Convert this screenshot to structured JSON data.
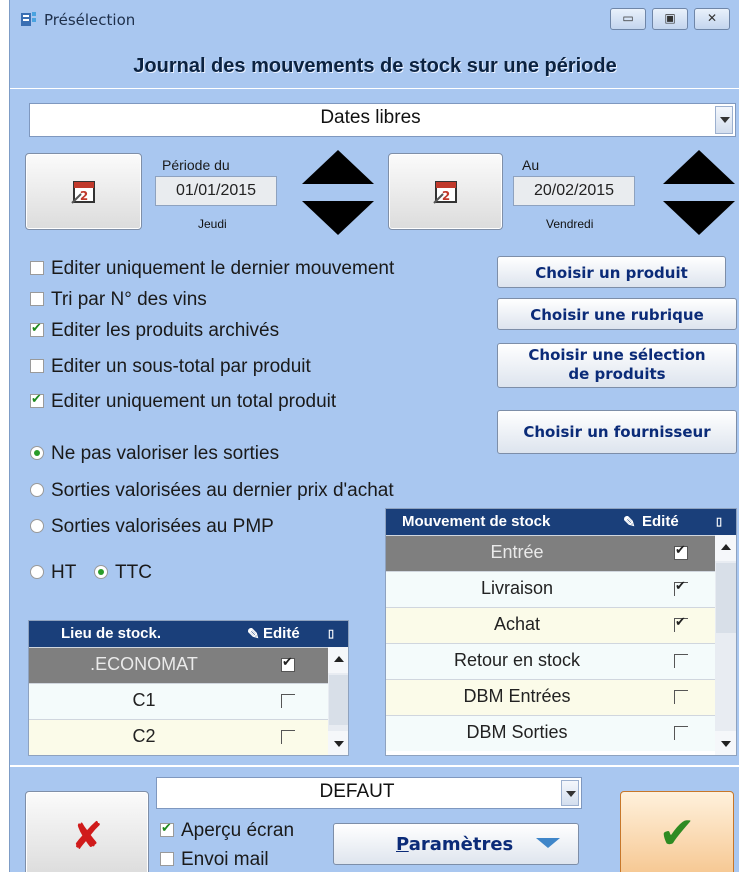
{
  "window": {
    "title": "Présélection",
    "header": "Journal des mouvements de stock sur une période"
  },
  "period_combo": {
    "value": "Dates libres"
  },
  "start": {
    "label": "Période du",
    "date": "01/01/2015",
    "day": "Jeudi"
  },
  "end": {
    "label": "Au",
    "date": "20/02/2015",
    "day": "Vendredi"
  },
  "checkboxes": [
    {
      "label": "Editer uniquement le dernier mouvement",
      "checked": false
    },
    {
      "label": "Tri par N° des vins",
      "checked": false
    },
    {
      "label": "Editer les produits archivés",
      "checked": true
    },
    {
      "label": "Editer un sous-total par produit",
      "checked": false
    },
    {
      "label": "Editer uniquement un total produit",
      "checked": true
    }
  ],
  "buttons": {
    "choose_product": "Choisir un produit",
    "choose_rubric": "Choisir une rubrique",
    "choose_selection_1": "Choisir une sélection",
    "choose_selection_2": "de produits",
    "choose_supplier": "Choisir un fournisseur"
  },
  "valuation": [
    {
      "label": "Ne pas valoriser les sorties",
      "selected": true
    },
    {
      "label": "Sorties valorisées au dernier prix d'achat",
      "selected": false
    },
    {
      "label": "Sorties valorisées au  PMP",
      "selected": false
    }
  ],
  "tax": {
    "ht": "HT",
    "ttc": "TTC",
    "selected": "TTC"
  },
  "lieu_table": {
    "col1": "Lieu de stock.",
    "col2": "Edité",
    "rows": [
      {
        "name": ".ECONOMAT",
        "checked": true,
        "selected": true
      },
      {
        "name": "C1",
        "checked": false
      },
      {
        "name": "C2",
        "checked": false
      }
    ]
  },
  "mvt_table": {
    "col1": "Mouvement de stock",
    "col2": "Edité",
    "rows": [
      {
        "name": "Entrée",
        "checked": true,
        "selected": true
      },
      {
        "name": "Livraison",
        "checked": true
      },
      {
        "name": "Achat",
        "checked": true
      },
      {
        "name": "Retour en stock",
        "checked": false
      },
      {
        "name": "DBM Entrées",
        "checked": false
      },
      {
        "name": "DBM Sorties",
        "checked": false
      }
    ]
  },
  "bottom": {
    "profile": "DEFAUT",
    "apercu": "Aperçu écran",
    "envoi": "Envoi mail",
    "params": "Paramètres",
    "params_underline": "P",
    "params_rest": "aramètres"
  },
  "icons": {
    "cancel": "red-x-icon",
    "ok": "green-check-icon",
    "calendar": "calendar-icon"
  }
}
